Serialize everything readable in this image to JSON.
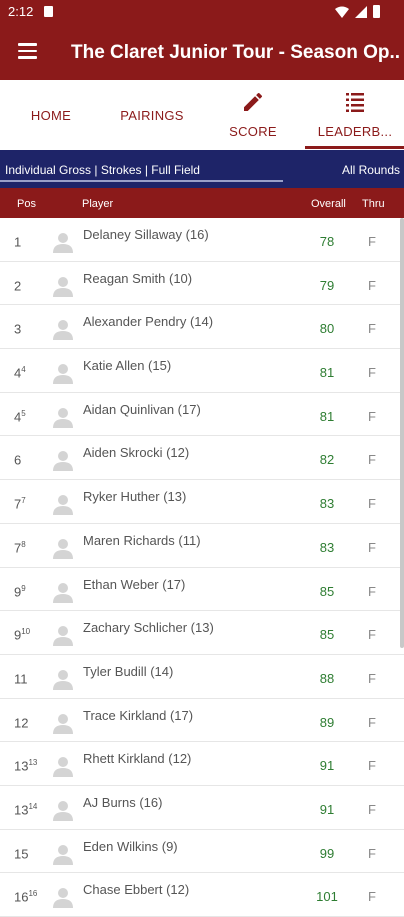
{
  "status": {
    "time": "2:12"
  },
  "app": {
    "title": "The Claret Junior Tour - Season Op..."
  },
  "tabs": [
    {
      "label": "HOME"
    },
    {
      "label": "PAIRINGS"
    },
    {
      "label": "SCORE",
      "icon": "pencil-icon"
    },
    {
      "label": "LEADERB...",
      "icon": "list-icon",
      "active": true
    }
  ],
  "filter": {
    "left": "Individual Gross | Strokes | Full Field",
    "right": "All Rounds"
  },
  "columns": {
    "pos": "Pos",
    "player": "Player",
    "overall": "Overall",
    "thru": "Thru"
  },
  "rows": [
    {
      "pos": "1",
      "tie": "",
      "player": "Delaney Sillaway (16)",
      "overall": "78",
      "thru": "F"
    },
    {
      "pos": "2",
      "tie": "",
      "player": "Reagan Smith (10)",
      "overall": "79",
      "thru": "F"
    },
    {
      "pos": "3",
      "tie": "",
      "player": "Alexander Pendry (14)",
      "overall": "80",
      "thru": "F"
    },
    {
      "pos": "4",
      "tie": "4",
      "player": "Katie Allen (15)",
      "overall": "81",
      "thru": "F"
    },
    {
      "pos": "4",
      "tie": "5",
      "player": "Aidan Quinlivan (17)",
      "overall": "81",
      "thru": "F"
    },
    {
      "pos": "6",
      "tie": "",
      "player": "Aiden Skrocki (12)",
      "overall": "82",
      "thru": "F"
    },
    {
      "pos": "7",
      "tie": "7",
      "player": "Ryker Huther (13)",
      "overall": "83",
      "thru": "F"
    },
    {
      "pos": "7",
      "tie": "8",
      "player": "Maren Richards (11)",
      "overall": "83",
      "thru": "F"
    },
    {
      "pos": "9",
      "tie": "9",
      "player": "Ethan  Weber (17)",
      "overall": "85",
      "thru": "F"
    },
    {
      "pos": "9",
      "tie": "10",
      "player": "Zachary Schlicher (13)",
      "overall": "85",
      "thru": "F"
    },
    {
      "pos": "11",
      "tie": "",
      "player": "Tyler Budill (14)",
      "overall": "88",
      "thru": "F"
    },
    {
      "pos": "12",
      "tie": "",
      "player": "Trace Kirkland (17)",
      "overall": "89",
      "thru": "F"
    },
    {
      "pos": "13",
      "tie": "13",
      "player": "Rhett Kirkland (12)",
      "overall": "91",
      "thru": "F"
    },
    {
      "pos": "13",
      "tie": "14",
      "player": "AJ Burns (16)",
      "overall": "91",
      "thru": "F"
    },
    {
      "pos": "15",
      "tie": "",
      "player": "Eden Wilkins (9)",
      "overall": "99",
      "thru": "F"
    },
    {
      "pos": "16",
      "tie": "16",
      "player": "Chase Ebbert (12)",
      "overall": "101",
      "thru": "F"
    }
  ],
  "colors": {
    "brand": "#8b1a1a",
    "filter_bg": "#1e2468",
    "score_green": "#2e7d32"
  }
}
